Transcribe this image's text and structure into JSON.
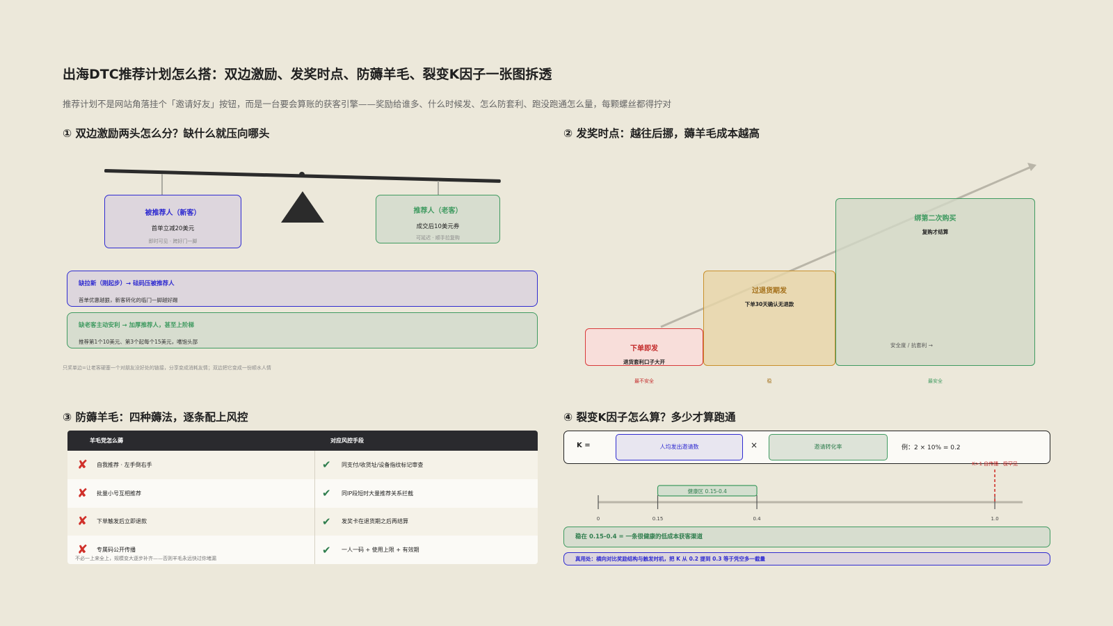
{
  "page": {
    "title": "出海DTC推荐计划怎么搭：双边激励、发奖时点、防薅羊毛、裂变K因子一张图拆透",
    "subtitle": "推荐计划不是网站角落挂个「邀请好友」按钮，而是一台要会算账的获客引擎——奖励给谁多、什么时候发、怎么防套利、跑没跑通怎么量，每颗螺丝都得拧对"
  },
  "section1": {
    "heading": "① 双边激励两头怎么分？缺什么就压向哪头",
    "left_box": {
      "title": "被推荐人（新客）",
      "main": "首单立减20美元",
      "note": "即时可见 · 跨好门一脚"
    },
    "right_box": {
      "title": "推荐人（老客）",
      "main": "成交后10美元券",
      "note": "可延迟 · 顺手拉复购"
    },
    "rules": [
      {
        "title": "缺拉新（刚起步）→ 砝码压被推荐人",
        "desc": "首单优惠越狠，新客转化的临门一脚越好踢"
      },
      {
        "title": "缺老客主动安利 → 加厚推荐人，甚至上阶梯",
        "desc": "推荐第1个10美元、第3个起每个15美元，嗜饱头部"
      }
    ],
    "footnote": "只奖单边=让老客硬塞一个对朋友没好处的链接，分享变成消耗友情；双边把它变成一份顺水人情",
    "colors": {
      "blue": "#2e2ad0",
      "green": "#3f9a60"
    }
  },
  "section2": {
    "heading": "② 发奖时点：越往后挪，薅羊毛成本越高",
    "steps": [
      {
        "title": "下单即发",
        "sub": "退货套利口子大开",
        "label": "最不安全"
      },
      {
        "title": "过退货期发",
        "sub": "下单30天确认无退款",
        "label": "稳"
      },
      {
        "title": "绑第二次购买",
        "sub": "复购才结算",
        "label": "最安全"
      }
    ],
    "arrow_label": "安全度 / 抗套利 →",
    "colors": {
      "red": "#d83a3a",
      "amber": "#c88f2a",
      "green": "#3f9a60"
    }
  },
  "section3": {
    "heading": "③ 防薅羊毛：四种薅法，逐条配上风控",
    "columns": [
      "羊毛党怎么薅",
      "对应风控手段"
    ],
    "rows": [
      {
        "attack": "自我推荐 · 左手倒右手",
        "defense": "同支付/收货址/设备指纹标记审查"
      },
      {
        "attack": "批量小号互相推荐",
        "defense": "同IP段短时大量推荐关系拦截"
      },
      {
        "attack": "下单触发后立即退款",
        "defense": "发奖卡在退货期之后再结算"
      },
      {
        "attack": "专属码公开传播",
        "defense": "一人一码 + 使用上限 + 有效期"
      }
    ],
    "note": "不必一上来全上，规模变大逐步补齐——否则羊毛永远快过你堵漏"
  },
  "section4": {
    "heading": "④ 裂变K因子怎么算？多少才算跑通",
    "formula": {
      "k_label": "K =",
      "factor1": "人均发出邀请数",
      "times": "×",
      "factor2": "邀请转化率",
      "example": "例：2 × 10% = 0.2"
    },
    "scale": {
      "ticks": [
        {
          "value": 0,
          "label": "0"
        },
        {
          "value": 0.15,
          "label": "0.15"
        },
        {
          "value": 0.4,
          "label": "0.4"
        },
        {
          "value": 1.0,
          "label": "1.0"
        }
      ],
      "min": 0,
      "max": 1.07,
      "healthy_range": [
        0.15,
        0.4
      ],
      "healthy_label": "健康区 0.15-0.4",
      "viral_value": 1.0,
      "viral_label": "K>1 自传播 · 极罕见"
    },
    "band1": "稳在 0.15-0.4 = 一条很健康的低成本获客渠道",
    "band2": "真用处：横向对比奖励结构与触发时机，把 K 从 0.2 提到 0.3 等于凭空多一截量"
  }
}
